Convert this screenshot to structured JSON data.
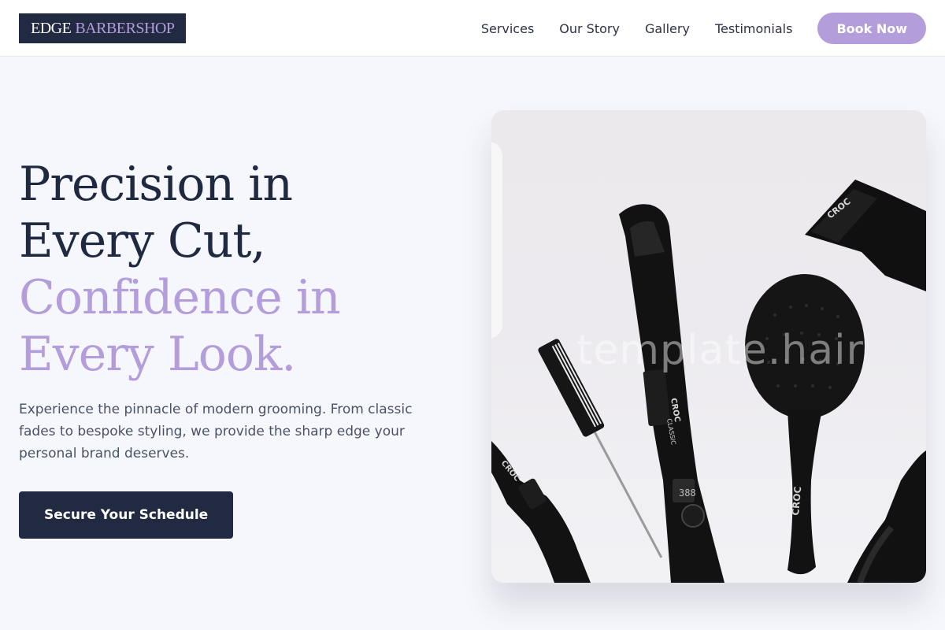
{
  "header": {
    "logo_primary": "EDGE",
    "logo_secondary": "BARBERSHOP",
    "nav": [
      {
        "label": "Services"
      },
      {
        "label": "Our Story"
      },
      {
        "label": "Gallery"
      },
      {
        "label": "Testimonials"
      }
    ],
    "book_label": "Book Now"
  },
  "hero": {
    "headline_line1": "Precision in",
    "headline_line2": "Every Cut,",
    "headline_line3": "Confidence in",
    "headline_line4": "Every Look.",
    "description": "Experience the pinnacle of modern grooming. From classic fades to bespoke styling, we provide the sharp edge your personal brand deserves.",
    "cta_label": "Secure Your Schedule"
  },
  "image": {
    "watermark": "template.hair",
    "brand_mark": "CROC",
    "iron_model": "CLASSIC",
    "iron_display": "388"
  },
  "colors": {
    "navy": "#212a41",
    "lavender": "#b39ddb",
    "background": "#f6f7fc"
  }
}
